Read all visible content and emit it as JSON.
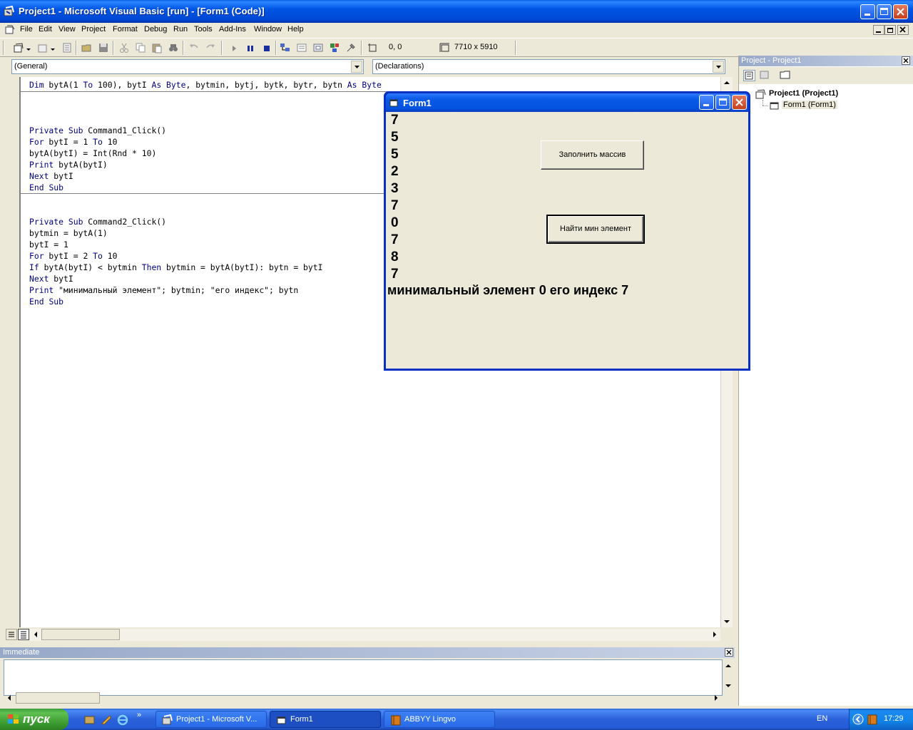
{
  "window": {
    "title": "Project1 - Microsoft Visual Basic [run] - [Form1 (Code)]"
  },
  "menu": {
    "items": [
      "File",
      "Edit",
      "View",
      "Project",
      "Format",
      "Debug",
      "Run",
      "Tools",
      "Add-Ins",
      "Window",
      "Help"
    ]
  },
  "toolbar": {
    "position_readout": "0, 0",
    "size_readout": "7710 x 5910"
  },
  "code_window": {
    "object_combo": "(General)",
    "procedure_combo": "(Declarations)",
    "lines": {
      "l1": "Dim bytA(1 To 100), bytI As Byte, bytmin, bytj, bytk, bytr, bytn As Byte",
      "l2": "Private Sub Command1_Click()",
      "l3": "For bytI = 1 To 10",
      "l4": "bytA(bytI) = Int(Rnd * 10)",
      "l5": "Print bytA(bytI)",
      "l6": "Next bytI",
      "l7": "End Sub",
      "l8": "Private Sub Command2_Click()",
      "l9": "bytmin = bytA(1)",
      "l10": "bytI = 1",
      "l11": "For bytI = 2 To 10",
      "l12": "If bytA(bytI) < bytmin Then bytmin = bytA(bytI): bytn = bytI",
      "l13": "Next bytI",
      "l14": "Print \"минимальный элемент\"; bytmin; \"его индекс\"; bytn",
      "l15": "End Sub"
    }
  },
  "form1": {
    "title": "Form1",
    "output": [
      "7",
      "5",
      "5",
      "2",
      "3",
      "7",
      "0",
      "7",
      "8",
      "7"
    ],
    "result": "минимальный элемент 0 его индекс 7",
    "button1": "Заполнить массив",
    "button2": "Найти мин элемент"
  },
  "project_explorer": {
    "title": "Project - Project1",
    "root": "Project1 (Project1)",
    "child": "Form1 (Form1)"
  },
  "immediate": {
    "title": "Immediate"
  },
  "taskbar": {
    "start": "пуск",
    "tasks": [
      "Project1 - Microsoft V...",
      "Form1",
      "ABBYY Lingvo"
    ],
    "lang": "EN",
    "clock": "17:29"
  },
  "colors": {
    "xp_blue": "#0054e3",
    "keyword": "#000080",
    "start_green": "#3c9e3c"
  }
}
